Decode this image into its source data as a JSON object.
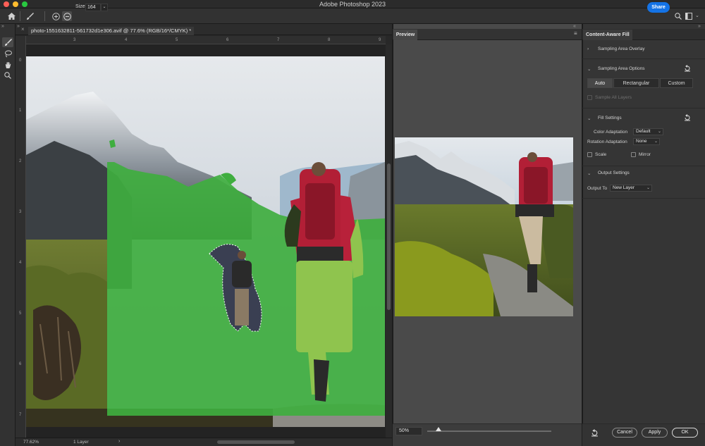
{
  "window": {
    "title": "Adobe Photoshop 2023"
  },
  "options_bar": {
    "size_label": "Size",
    "size_value": "164",
    "share_label": "Share"
  },
  "document": {
    "tab_title": "photo-1551632811-561732d1e306.avif @ 77.6% (RGB/16*/CMYK) *",
    "ruler_top_ticks": [
      "3",
      "4",
      "5",
      "6",
      "7",
      "8",
      "9"
    ],
    "ruler_left_ticks": [
      "0",
      "1",
      "2",
      "3",
      "4",
      "5",
      "6",
      "7"
    ],
    "zoom": "77.62%",
    "layers_status": "1 Layer"
  },
  "preview": {
    "tab_label": "Preview",
    "zoom_value": "50%",
    "zoom_slider_fraction": 0.09
  },
  "content_aware_fill": {
    "panel_title": "Content-Aware Fill",
    "sampling_area_overlay": "Sampling Area Overlay",
    "sampling_area_options": "Sampling Area Options",
    "sampling_modes": [
      "Auto",
      "Rectangular",
      "Custom"
    ],
    "selected_sampling_mode": "Auto",
    "sample_all_layers": "Sample All Layers",
    "fill_settings": "Fill Settings",
    "color_adaptation_label": "Color Adaptation",
    "color_adaptation_value": "Default",
    "rotation_adaptation_label": "Rotation Adaptation",
    "rotation_adaptation_value": "None",
    "scale_label": "Scale",
    "mirror_label": "Mirror",
    "output_settings": "Output Settings",
    "output_to_label": "Output To",
    "output_to_value": "New Layer",
    "cancel_label": "Cancel",
    "apply_label": "Apply",
    "ok_label": "OK"
  },
  "colors": {
    "accent_blue": "#1473e6",
    "sampling_overlay_green": "#3fae3f"
  },
  "icons": {
    "traffic_lights": [
      "close-dot",
      "minimize-dot",
      "zoom-dot"
    ],
    "toolbar": [
      "home-icon",
      "brush-icon",
      "add-icon",
      "subtract-icon"
    ],
    "tools": [
      "brush-tool-icon",
      "lasso-icon",
      "hand-icon",
      "zoom-icon"
    ],
    "right": [
      "search-icon",
      "workspace-icon",
      "panel-toggle-icon"
    ]
  }
}
